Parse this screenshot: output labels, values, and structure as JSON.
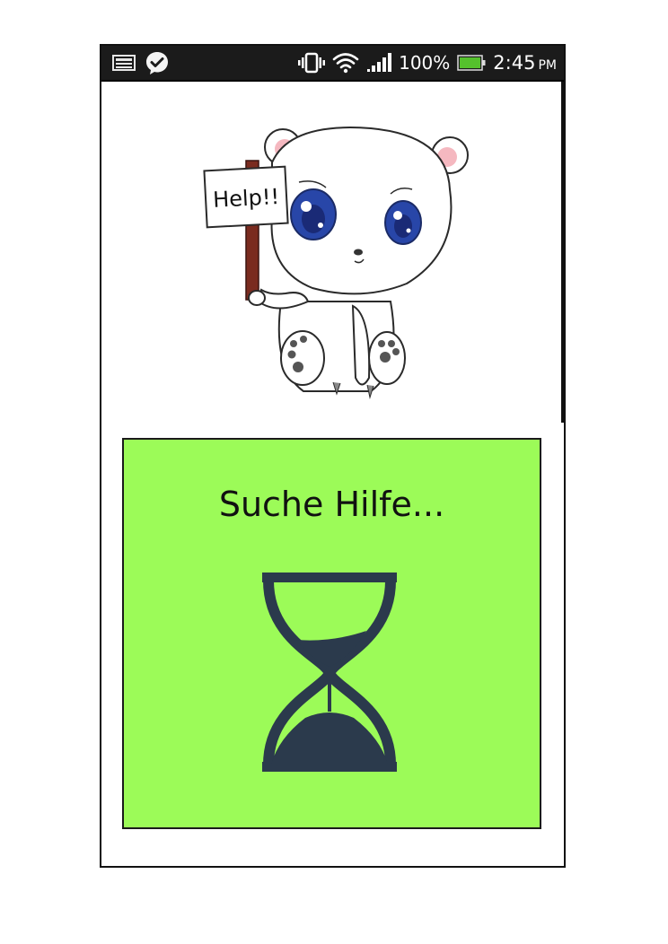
{
  "status_bar": {
    "battery_percent": "100%",
    "battery_level": 1.0,
    "time": "2:45",
    "ampm": "PM",
    "left_icons": [
      "notification-card-icon",
      "messenger-check-icon"
    ],
    "right_icons": [
      "vibrate-icon",
      "wifi-icon",
      "signal-icon",
      "battery-icon"
    ]
  },
  "illustration": {
    "sign_text": "Help!!"
  },
  "status_card": {
    "text": "Suche Hilfe...",
    "icon": "hourglass-icon",
    "background_color": "#9cfb58",
    "icon_color": "#2b3a4c"
  }
}
